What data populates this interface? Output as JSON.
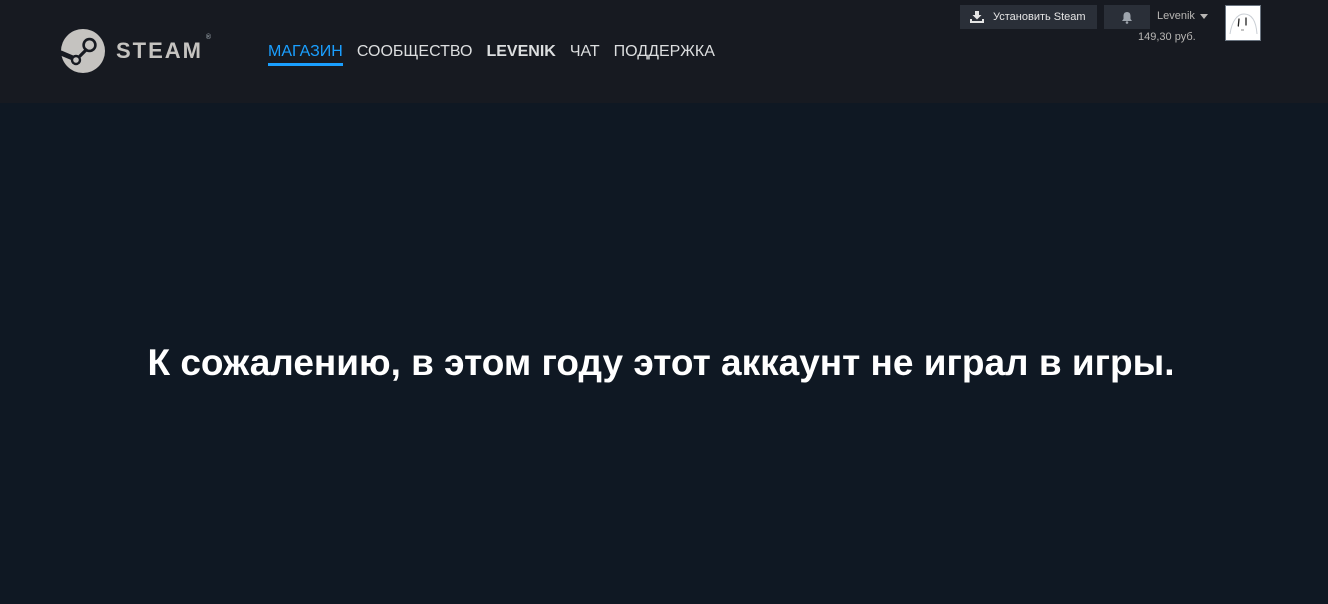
{
  "brand": {
    "logo_text": "STEAM",
    "reg_mark": "®"
  },
  "nav": {
    "items": [
      {
        "label": "МАГАЗИН",
        "active": true
      },
      {
        "label": "СООБЩЕСТВО"
      },
      {
        "label": "LEVENIK",
        "bold": true
      },
      {
        "label": "ЧАТ"
      },
      {
        "label": "ПОДДЕРЖКА"
      }
    ]
  },
  "global_actions": {
    "install_label": "Установить Steam",
    "account_name": "Levenik",
    "balance": "149,30 руб."
  },
  "main": {
    "message": "К сожалению, в этом году этот аккаунт не играл в игры."
  },
  "colors": {
    "page_bg": "#0f1823",
    "header_bg": "#171a21",
    "active_nav": "#1a9fff",
    "button_bg": "#2a2f38"
  },
  "icons": {
    "logo": "steam-logo-icon",
    "install": "steam-download-icon",
    "notifications": "bell-icon",
    "account_menu": "caret-down-icon"
  }
}
